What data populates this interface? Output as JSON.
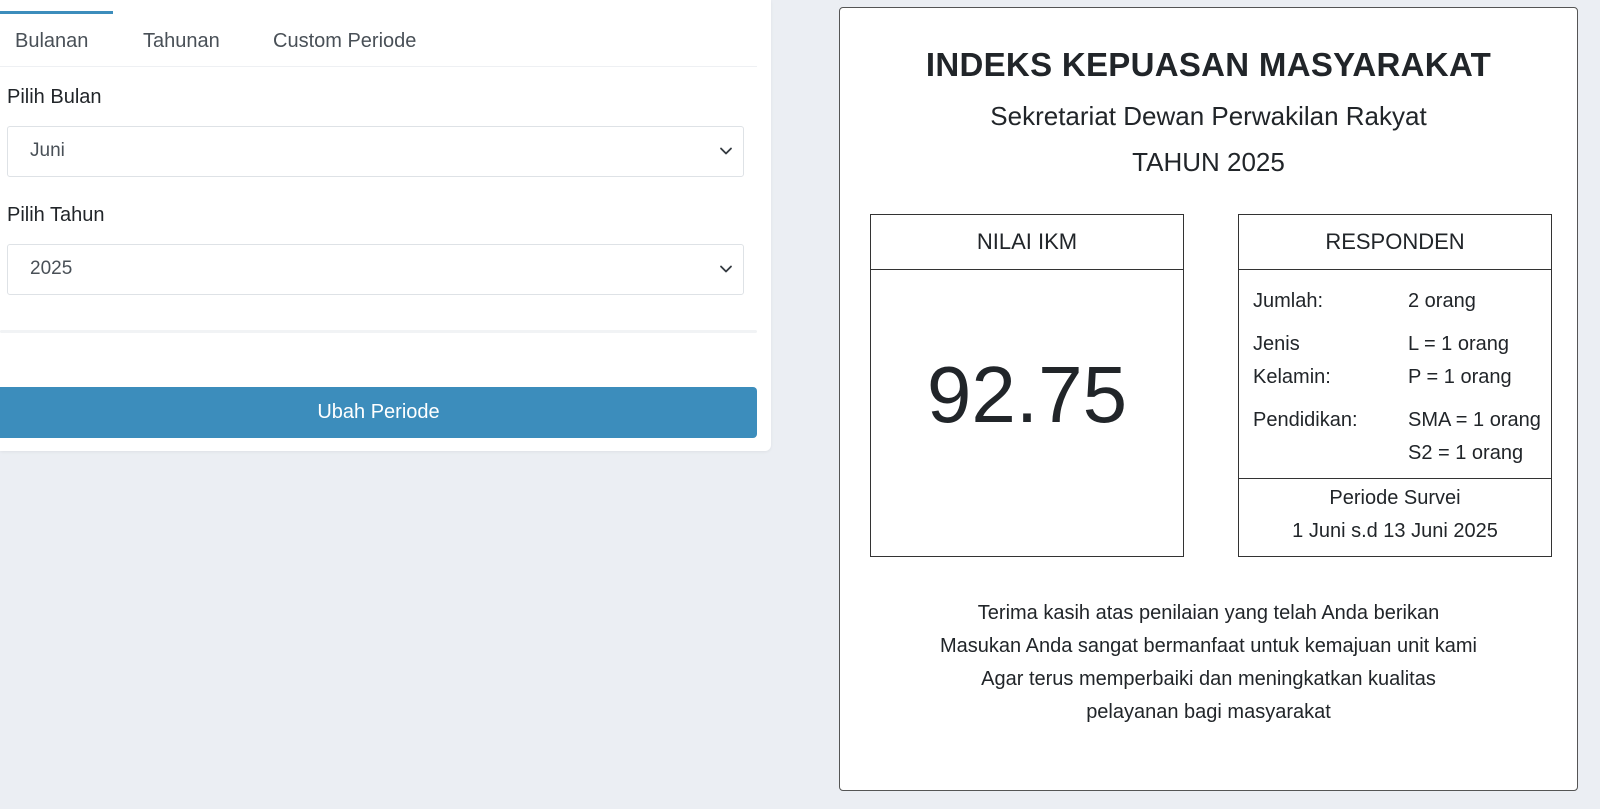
{
  "tabs": [
    {
      "label": "Bulanan",
      "active": true
    },
    {
      "label": "Tahunan",
      "active": false
    },
    {
      "label": "Custom Periode",
      "active": false
    }
  ],
  "form": {
    "month_label": "Pilih Bulan",
    "month_value": "Juni",
    "year_label": "Pilih Tahun",
    "year_value": "2025",
    "submit_label": "Ubah Periode"
  },
  "certificate": {
    "title": "INDEKS KEPUASAN MASYARAKAT",
    "subtitle": "Sekretariat Dewan Perwakilan Rakyat",
    "year_line": "TAHUN 2025",
    "ikm": {
      "header": "NILAI IKM",
      "value": "92.75"
    },
    "respondents": {
      "header": "RESPONDEN",
      "count_label": "Jumlah:",
      "count_value": "2 orang",
      "gender_label_1": "Jenis",
      "gender_label_2": "Kelamin:",
      "gender_male": "L = 1 orang",
      "gender_female": "P = 1 orang",
      "education_label": "Pendidikan:",
      "education_1": "SMA = 1 orang",
      "education_2": "S2 = 1 orang",
      "period_label": "Periode Survei",
      "period_value": "1 Juni s.d 13 Juni 2025"
    },
    "thanks": [
      "Terima kasih atas penilaian yang telah Anda berikan",
      "Masukan Anda sangat bermanfaat untuk kemajuan unit kami",
      "Agar terus memperbaiki dan meningkatkan kualitas",
      "pelayanan bagi masyarakat"
    ]
  },
  "colors": {
    "accent": "#3c8dbc",
    "page_bg": "#ebeef3",
    "card_bg": "#ffffff",
    "border": "#333333"
  },
  "icons": {
    "select_arrow": "chevron-down-icon"
  }
}
